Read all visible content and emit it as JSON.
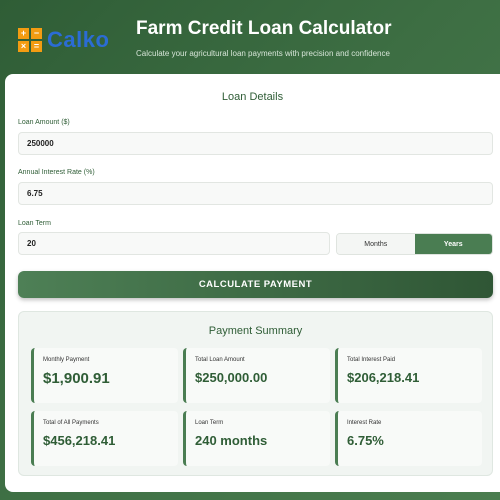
{
  "header": {
    "logo_symbols": [
      "+",
      "−",
      "×",
      "="
    ],
    "logo_text": "Calko",
    "title": "Farm Credit Loan Calculator",
    "subtitle": "Calculate your agricultural loan payments with precision and confidence"
  },
  "form": {
    "section_title": "Loan Details",
    "loan_amount": {
      "label": "Loan Amount ($)",
      "value": "250000"
    },
    "interest_rate": {
      "label": "Annual Interest Rate (%)",
      "value": "6.75"
    },
    "loan_term": {
      "label": "Loan Term",
      "value": "20"
    },
    "term_unit_options": [
      "Months",
      "Years"
    ],
    "term_unit_selected": "Years",
    "calculate_label": "CALCULATE PAYMENT"
  },
  "summary": {
    "title": "Payment Summary",
    "stats": [
      {
        "label": "Monthly Payment",
        "value": "$1,900.91"
      },
      {
        "label": "Total Loan Amount",
        "value": "$250,000.00"
      },
      {
        "label": "Total Interest Paid",
        "value": "$206,218.41"
      },
      {
        "label": "Total of All Payments",
        "value": "$456,218.41"
      },
      {
        "label": "Loan Term",
        "value": "240 months"
      },
      {
        "label": "Interest Rate",
        "value": "6.75%"
      }
    ]
  },
  "colors": {
    "primary_green": "#2f5d36",
    "accent_green": "#4a7d52",
    "logo_orange": "#f39c12",
    "logo_blue": "#2b6cd4"
  }
}
